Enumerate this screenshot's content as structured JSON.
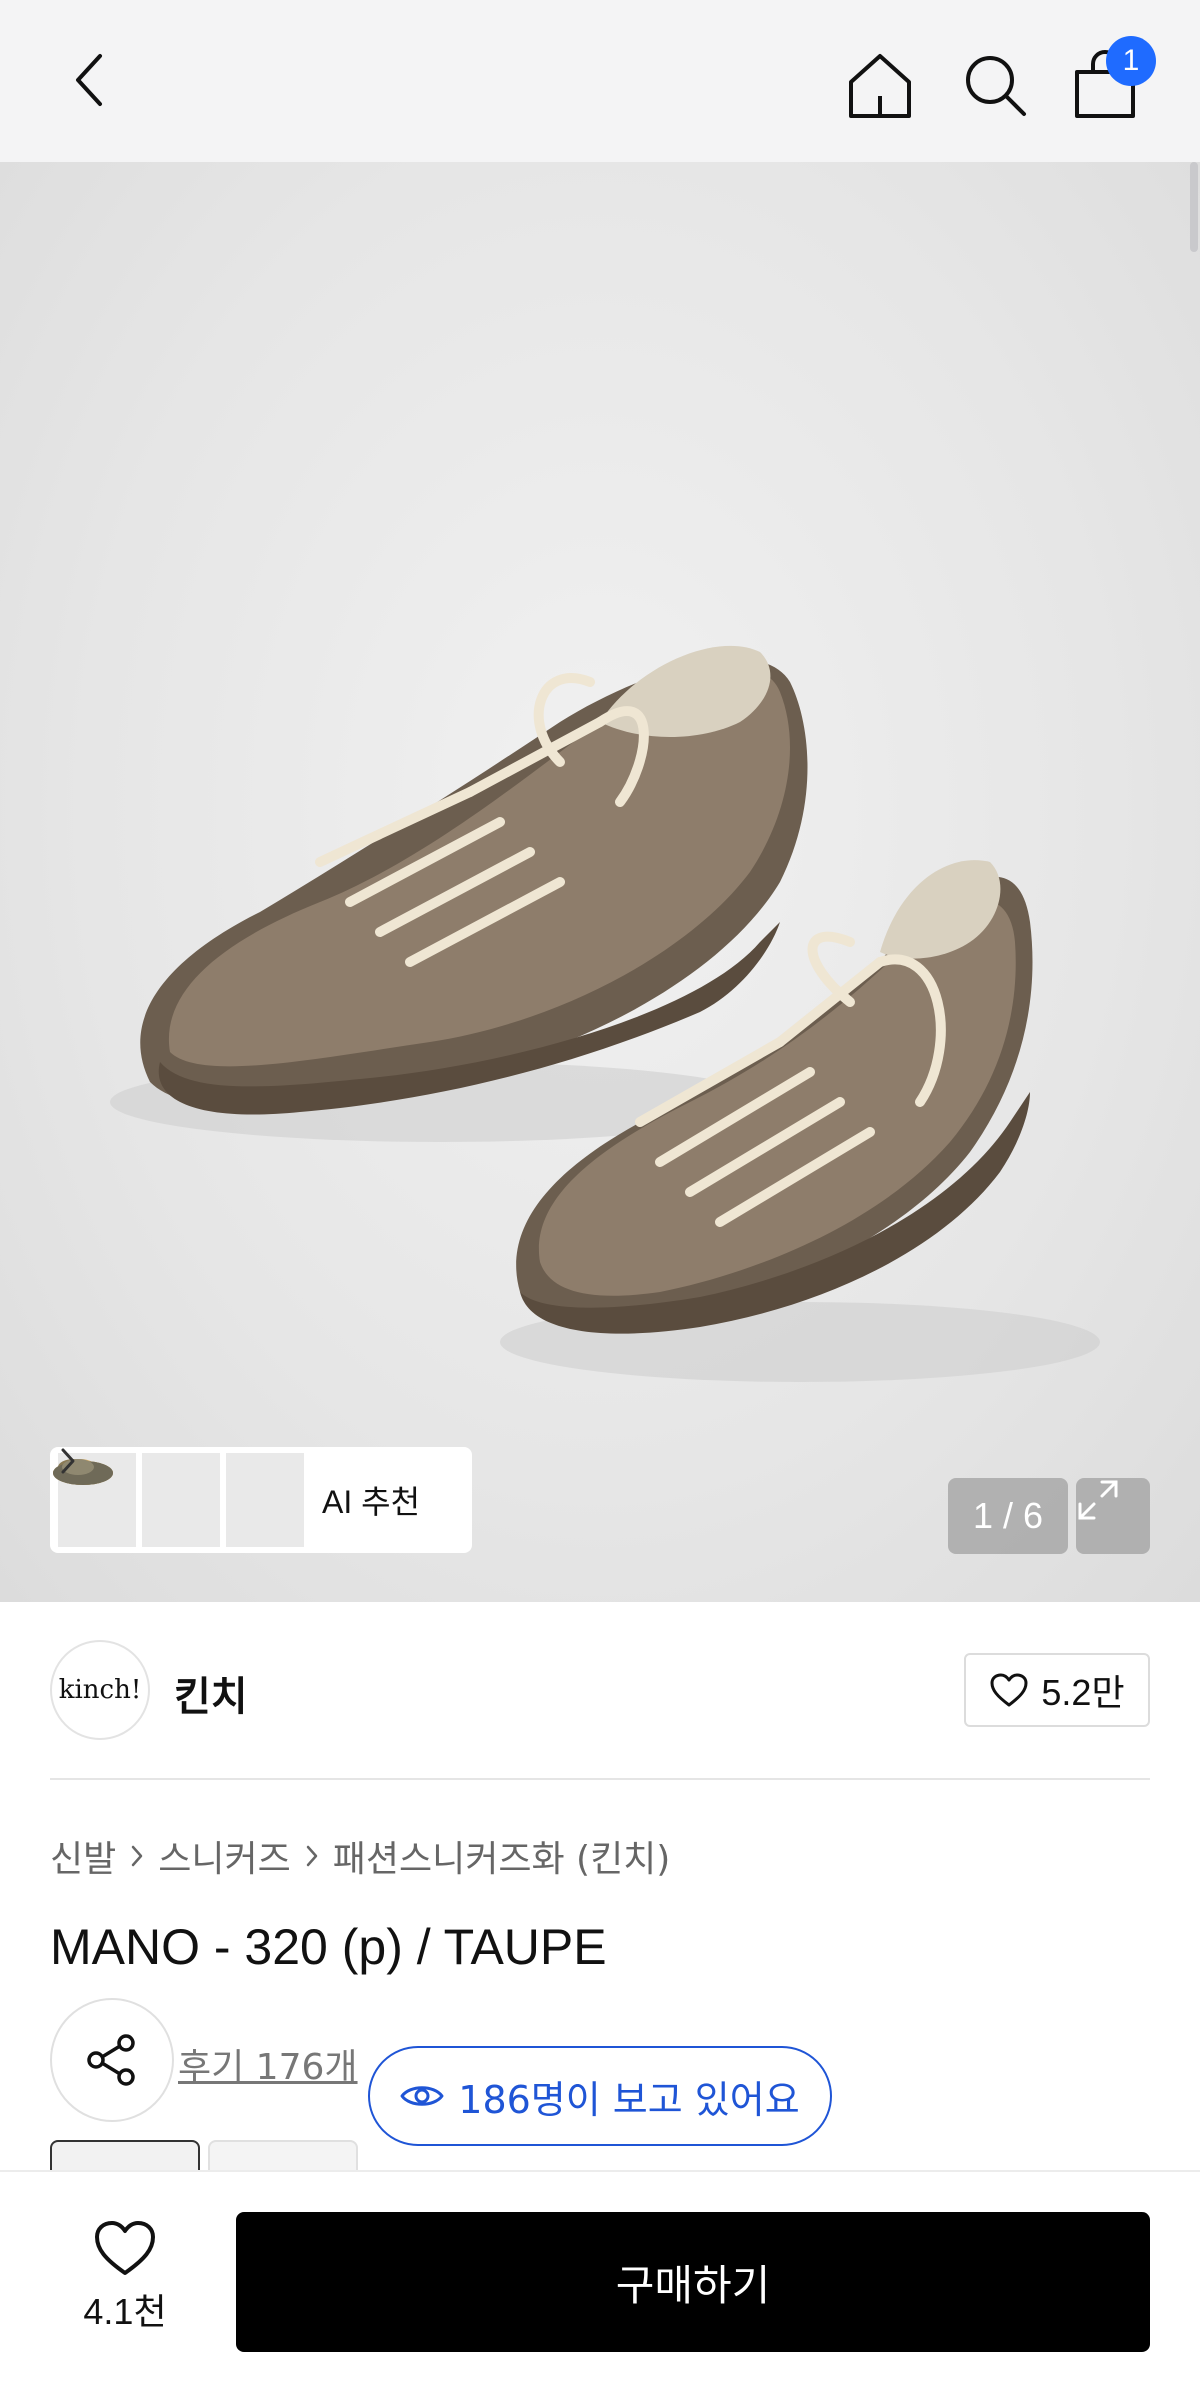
{
  "header": {
    "back_icon": "chevron-left-icon",
    "home_icon": "home-icon",
    "search_icon": "search-icon",
    "cart_icon": "shopping-bag-icon",
    "cart_count": "1"
  },
  "gallery": {
    "ai_recommend_label": "AI 추천",
    "counter": "1 / 6",
    "expand_icon": "expand-icon"
  },
  "brand": {
    "logo_text": "kinch!",
    "name": "킨치",
    "like_count": "5.2만"
  },
  "breadcrumb": [
    "신발",
    "스니커즈",
    "패션스니커즈화 (킨치)"
  ],
  "product": {
    "title": "MANO - 320 (p) / TAUPE",
    "reviews": "후기 176개",
    "viewers": "186명이 보고 있어요"
  },
  "bottom_bar": {
    "wish_count": "4.1천",
    "buy_label": "구매하기"
  },
  "colors": {
    "accent_blue": "#1f55d6",
    "badge_blue": "#1f6bff",
    "buy_button": "#000000"
  }
}
